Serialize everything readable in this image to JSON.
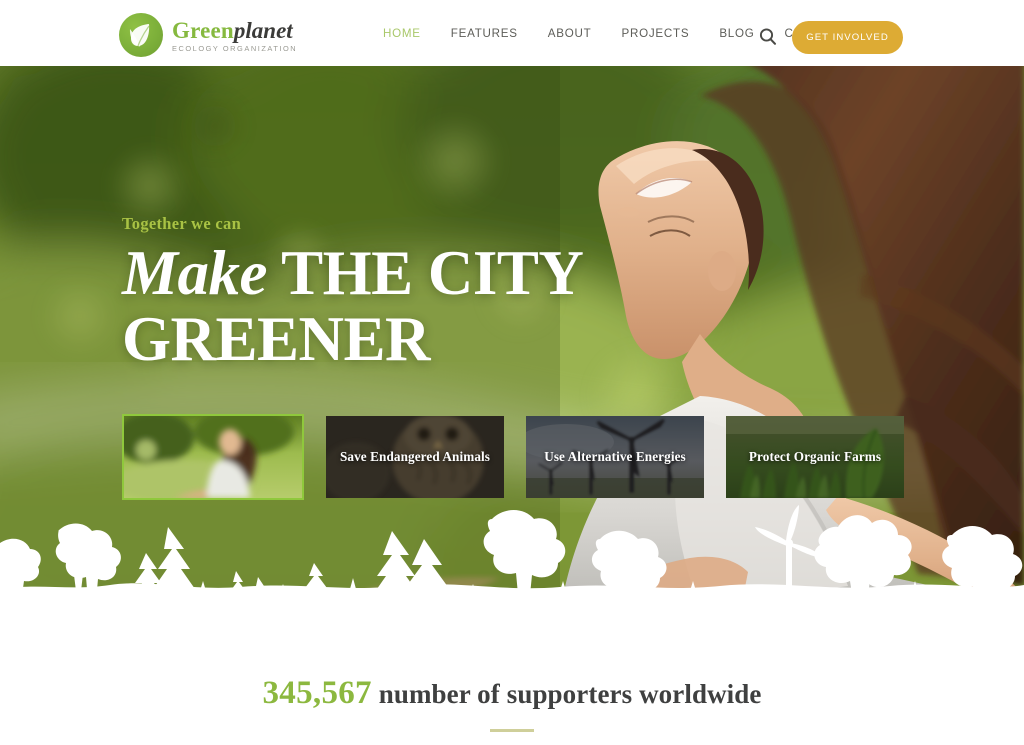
{
  "brand": {
    "name_green": "Green",
    "name_dark": "planet",
    "tagline": "ECOLOGY ORGANIZATION",
    "logo_icon": "leaf-circle-icon"
  },
  "nav": {
    "items": [
      {
        "label": "HOME",
        "active": true
      },
      {
        "label": "FEATURES",
        "active": false
      },
      {
        "label": "ABOUT",
        "active": false
      },
      {
        "label": "PROJECTS",
        "active": false
      },
      {
        "label": "BLOG",
        "active": false
      },
      {
        "label": "CONTACTS",
        "active": false
      }
    ],
    "search_icon": "search-icon",
    "cta_label": "GET INVOLVED",
    "cta_color": "#ddab34"
  },
  "hero": {
    "eyebrow": "Together we can",
    "headline_italic": "Make",
    "headline_rest": " THE CITY",
    "headline_line2": "GREENER",
    "eyebrow_color": "#a9c244",
    "active_border_color": "#8fc83c",
    "image_description": "Woman with long brown hair leaning back joyfully with arms outstretched in a sunlit green park"
  },
  "cards": [
    {
      "caption": "",
      "active": true,
      "image_description": "Woman sitting on grass in a green park"
    },
    {
      "caption": "Save Endangered Animals",
      "active": false,
      "image_description": "Close-up of an owl"
    },
    {
      "caption": "Use Alternative Energies",
      "active": false,
      "image_description": "Wind turbines at dusk"
    },
    {
      "caption": "Protect Organic Farms",
      "active": false,
      "image_description": "Green leafy crops in a field"
    }
  ],
  "supporters": {
    "count": "345,567",
    "label": " number of supporters worldwide",
    "count_color": "#8cb83f"
  }
}
